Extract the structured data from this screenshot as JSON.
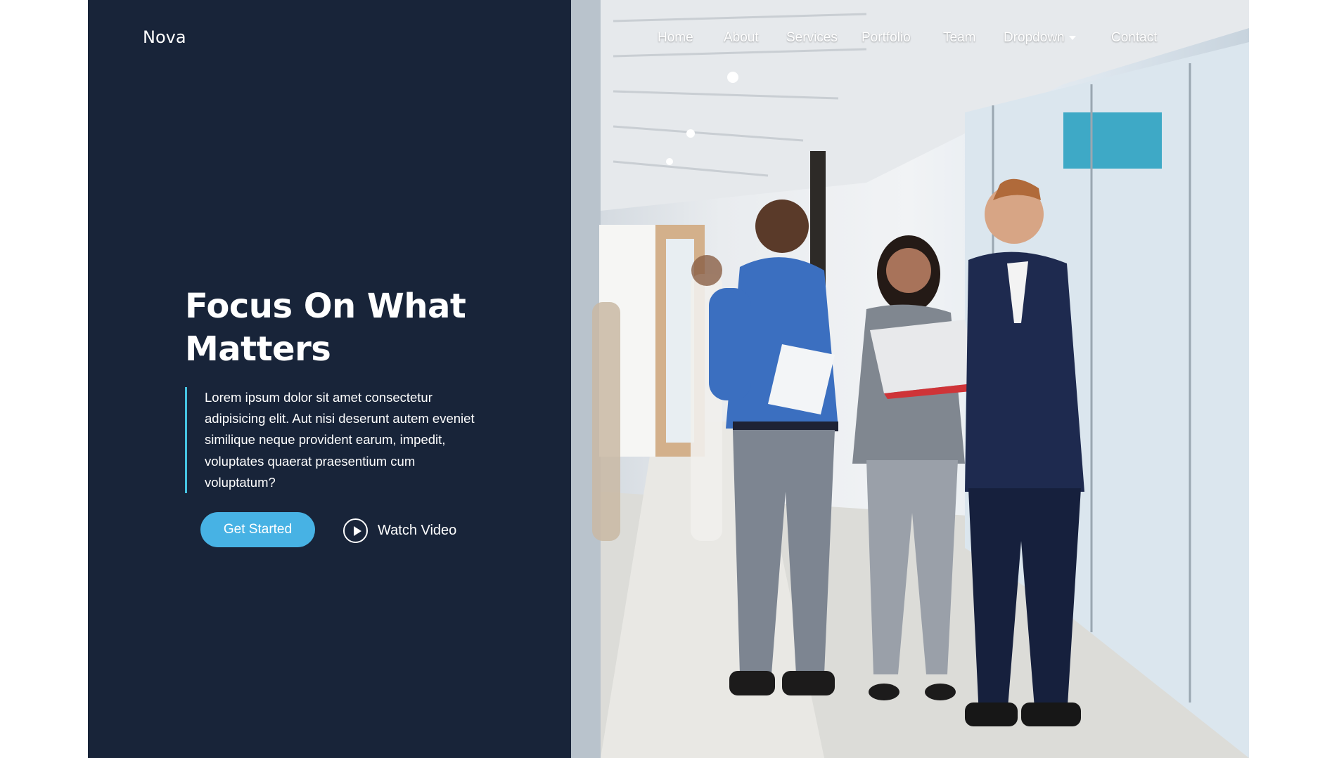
{
  "brand": {
    "name": "Nova"
  },
  "nav": {
    "items": [
      {
        "label": "Home"
      },
      {
        "label": "About"
      },
      {
        "label": "Services"
      },
      {
        "label": "Portfolio"
      },
      {
        "label": "Team"
      },
      {
        "label": "Dropdown"
      },
      {
        "label": "Contact"
      }
    ]
  },
  "hero": {
    "title": "Focus On What Matters",
    "description": "Lorem ipsum dolor sit amet consectetur adipisicing elit. Aut nisi deserunt autem eveniet similique neque provident earum, impedit, voluptates quaerat praesentium cum voluptatum?",
    "primary_button": "Get Started",
    "video_button": "Watch Video"
  },
  "colors": {
    "panel_bg": "#182439",
    "accent": "#47b2e4",
    "quote_bar": "#45c2e1"
  },
  "icons": {
    "dropdown": "caret-down-icon",
    "video": "play-circle-icon"
  }
}
